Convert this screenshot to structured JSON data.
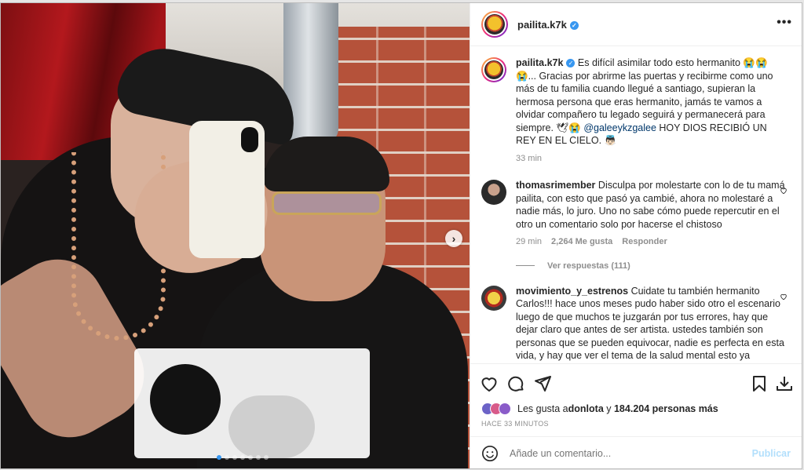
{
  "post": {
    "username": "pailita.k7k",
    "verified_glyph": "✓",
    "more_label": "•••"
  },
  "caption": {
    "username": "pailita.k7k",
    "text_part1": " Es difícil asimilar todo esto hermanito 😭😭😭... Gracias por abrirme las puertas y recibirme como uno más de tu familia cuando llegué a santiago, supieran la hermosa persona que eras hermanito, jamás te vamos a olvidar compañero tu legado seguirá y permanecerá para siempre. 🕊😭 ",
    "mention": "@galeeykzgalee",
    "text_part2": " HOY DIOS RECIBIÓ UN REY EN EL CIELO. 👼🏻",
    "time": "33 min"
  },
  "comments": [
    {
      "username": "thomasrimember",
      "text": " Disculpa por molestarte con lo de tu mamá pailita, con esto que pasó ya cambié, ahora no molestaré a nadie más, lo juro. Uno no sabe cómo puede repercutir en el otro un comentario solo por hacerse el chistoso",
      "time": "29 min",
      "likes": "2,264 Me gusta",
      "reply_label": "Responder",
      "view_replies": "Ver respuestas (111)"
    },
    {
      "username": "movimiento_y_estrenos",
      "text": " Cuidate tu también hermanito Carlos!!! hace unos meses pudo haber sido otro el escenario luego de que muchos te juzgarán por tus errores, hay que dejar claro que antes de ser artista. ustedes también son personas que se pueden equivocar, nadie es perfecta en esta vida, y hay que ver el tema de la salud mental esto ya"
    }
  ],
  "likes": {
    "prefix": "Les gusta a ",
    "first_user": "donlota",
    "middle": " y ",
    "count": "184.204 personas más"
  },
  "time_ago": "HACE 33 MINUTOS",
  "add_comment": {
    "placeholder": "Añade un comentario...",
    "publish_label": "Publicar"
  },
  "carousel": {
    "next_glyph": "›",
    "total_slides": 7,
    "active_index": 0
  },
  "icons": {
    "like": "heart-icon",
    "comment": "comment-icon",
    "share": "share-icon",
    "save": "bookmark-icon",
    "download": "download-icon",
    "emoji": "emoji-icon"
  },
  "colors": {
    "link": "#00376b",
    "verified": "#3897f0",
    "muted": "#8e8e8e",
    "publish_disabled": "#b2dffc"
  }
}
